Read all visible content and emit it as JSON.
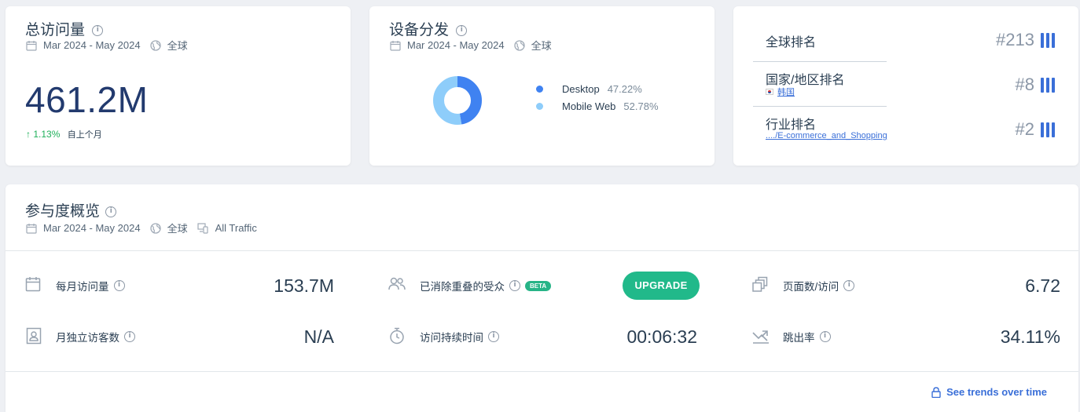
{
  "visits_card": {
    "title": "总访问量",
    "date_range": "Mar 2024 - May 2024",
    "region": "全球",
    "value": "461.2M",
    "change": "1.13%",
    "change_suffix": "自上个月",
    "change_direction": "up"
  },
  "device_card": {
    "title": "设备分发",
    "date_range": "Mar 2024 - May 2024",
    "region": "全球",
    "items": [
      {
        "label": "Desktop",
        "pct": "47.22%",
        "value": 47.22,
        "color": "#3f82f1"
      },
      {
        "label": "Mobile Web",
        "pct": "52.78%",
        "value": 52.78,
        "color": "#8ecdfa"
      }
    ]
  },
  "rank_card": {
    "global_label": "全球排名",
    "global_value": "#213",
    "country_label": "国家/地区排名",
    "country_name": "韩国",
    "country_value": "#8",
    "industry_label": "行业排名",
    "industry_path": "..../E-commerce_and_Shopping",
    "industry_value": "#2",
    "bar_color": "#3a6fd8"
  },
  "engagement": {
    "title": "参与度概览",
    "date_range": "Mar 2024 - May 2024",
    "region": "全球",
    "traffic": "All Traffic",
    "monthly_visits_label": "每月访问量",
    "monthly_visits_value": "153.7M",
    "unique_label": "月独立访客数",
    "unique_value": "N/A",
    "dedup_label": "已消除重叠的受众",
    "beta": "BETA",
    "upgrade": "UPGRADE",
    "duration_label": "访问持续时间",
    "duration_value": "00:06:32",
    "pages_label": "页面数/访问",
    "pages_value": "6.72",
    "bounce_label": "跳出率",
    "bounce_value": "34.11%",
    "trends_link": "See trends over time",
    "accent_color": "#21b98a"
  }
}
